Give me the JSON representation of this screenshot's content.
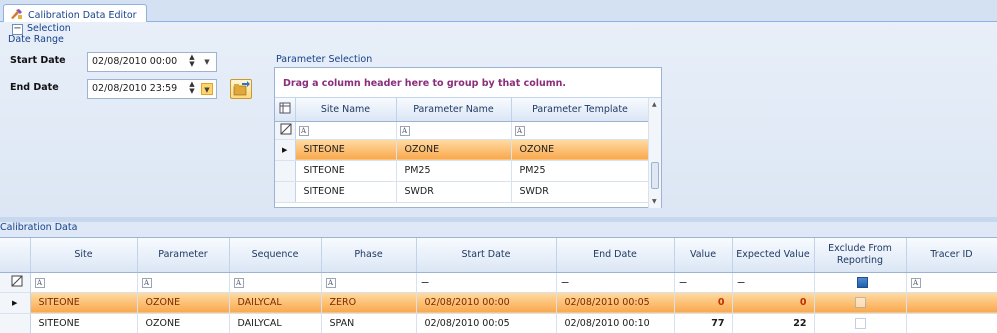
{
  "tab": {
    "label": "Calibration Data Editor",
    "icon": "calibration-tools-icon"
  },
  "selection": {
    "title": "Selection",
    "collapse_symbol": "−",
    "date_range": {
      "title": "Date Range",
      "start_label": "Start Date",
      "start_value": "02/08/2010 00:00",
      "end_label": "End Date",
      "end_value": "02/08/2010 23:59"
    },
    "parameter_selection": {
      "title": "Parameter Selection",
      "group_hint": "Drag a column header here to group by that column.",
      "columns": [
        "Site Name",
        "Parameter Name",
        "Parameter Template"
      ],
      "rows": [
        [
          "SITEONE",
          "OZONE",
          "OZONE"
        ],
        [
          "SITEONE",
          "PM25",
          "PM25"
        ],
        [
          "SITEONE",
          "SWDR",
          "SWDR"
        ]
      ],
      "selected_row": 0
    }
  },
  "calibration": {
    "title": "Calibration Data",
    "columns": [
      "Site",
      "Parameter",
      "Sequence",
      "Phase",
      "Start Date",
      "End Date",
      "Value",
      "Expected Value",
      "Exclude From Reporting",
      "Tracer ID"
    ],
    "rows": [
      {
        "site": "SITEONE",
        "parameter": "OZONE",
        "sequence": "DAILYCAL",
        "phase": "ZERO",
        "start": "02/08/2010 00:00",
        "end": "02/08/2010 00:05",
        "value": "0",
        "expected": "0",
        "exclude": false,
        "tracer": ""
      },
      {
        "site": "SITEONE",
        "parameter": "OZONE",
        "sequence": "DAILYCAL",
        "phase": "SPAN",
        "start": "02/08/2010 00:05",
        "end": "02/08/2010 00:10",
        "value": "77",
        "expected": "22",
        "exclude": false,
        "tracer": ""
      }
    ],
    "selected_row": 0
  },
  "colors": {
    "selected_row": "#f9a84c",
    "group_hint": "#8a2d7b",
    "header_text": "#15428b"
  }
}
